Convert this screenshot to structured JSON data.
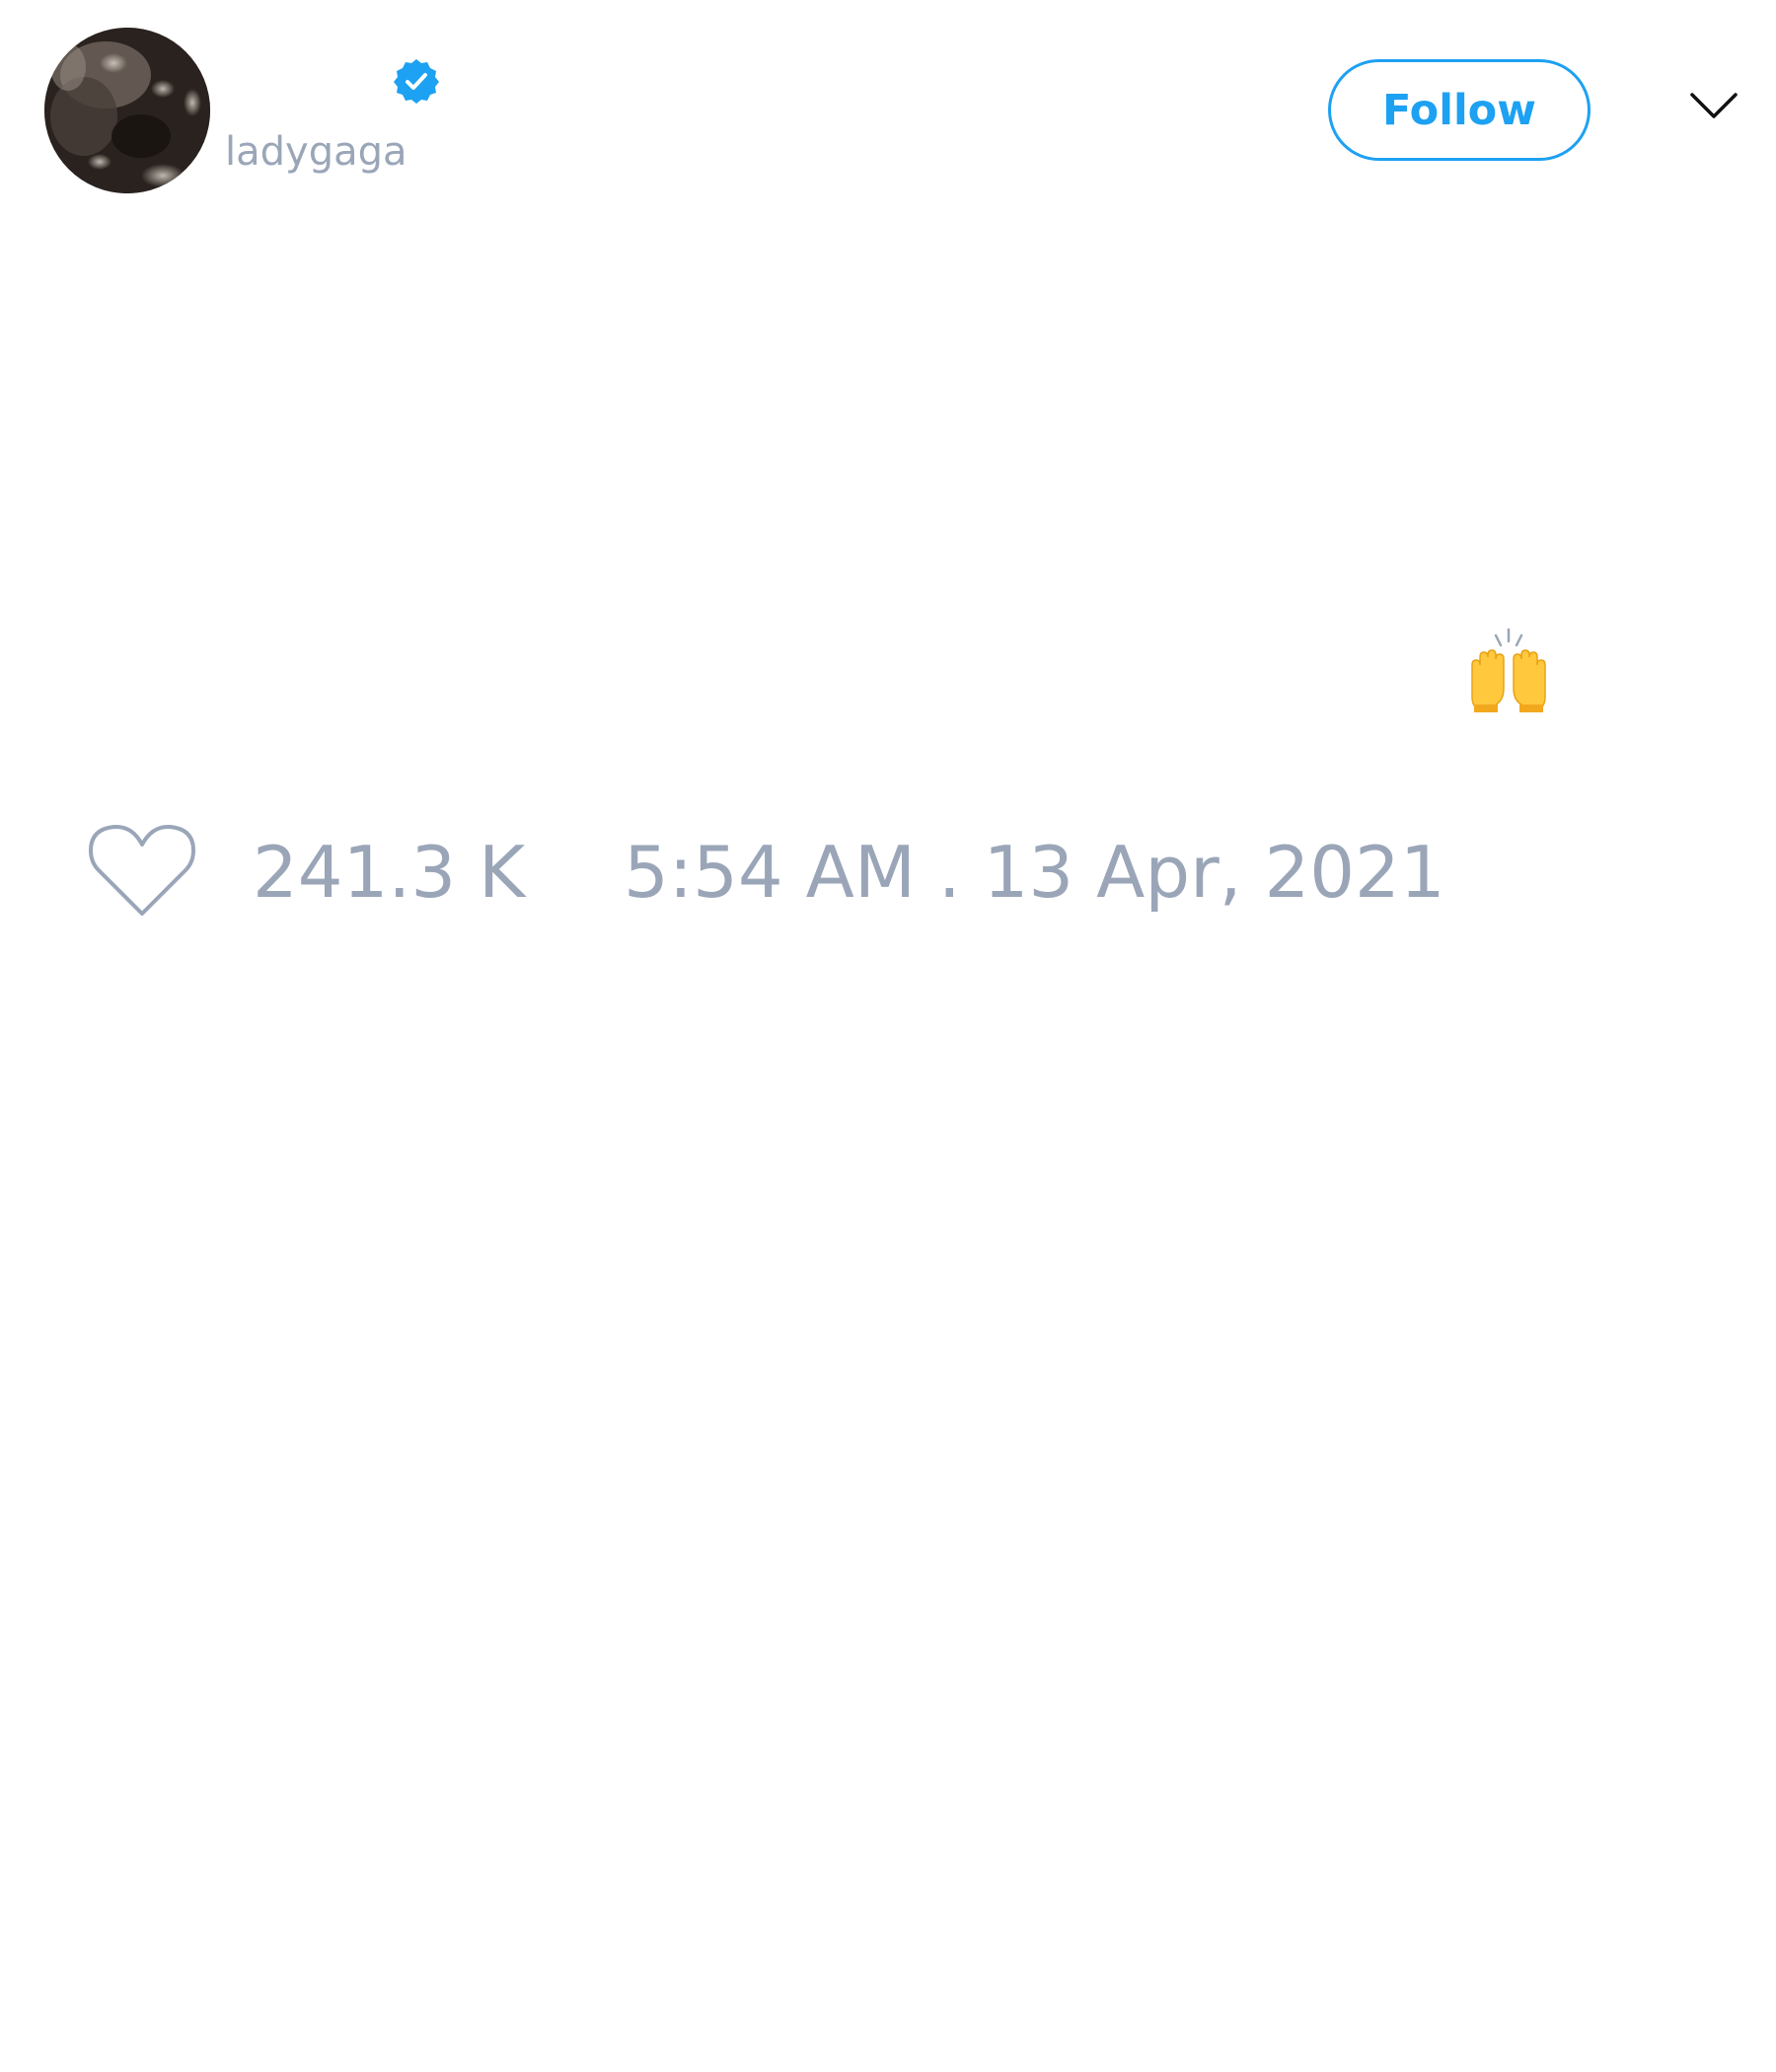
{
  "account": {
    "username": "ladygaga",
    "verified": true
  },
  "header": {
    "follow_label": "Follow"
  },
  "tweet": {
    "emoji": "🙌",
    "emoji_name": "raising-hands"
  },
  "footer": {
    "like_count": "241.3 K",
    "timestamp": "5:54 AM . 13 Apr, 2021"
  },
  "colors": {
    "accent": "#1da1f2",
    "muted_text": "#9aa6b8",
    "background": "#ffffff"
  },
  "icons": {
    "verified": "verified-badge-icon",
    "menu": "chevron-down-icon",
    "like": "heart-icon"
  }
}
